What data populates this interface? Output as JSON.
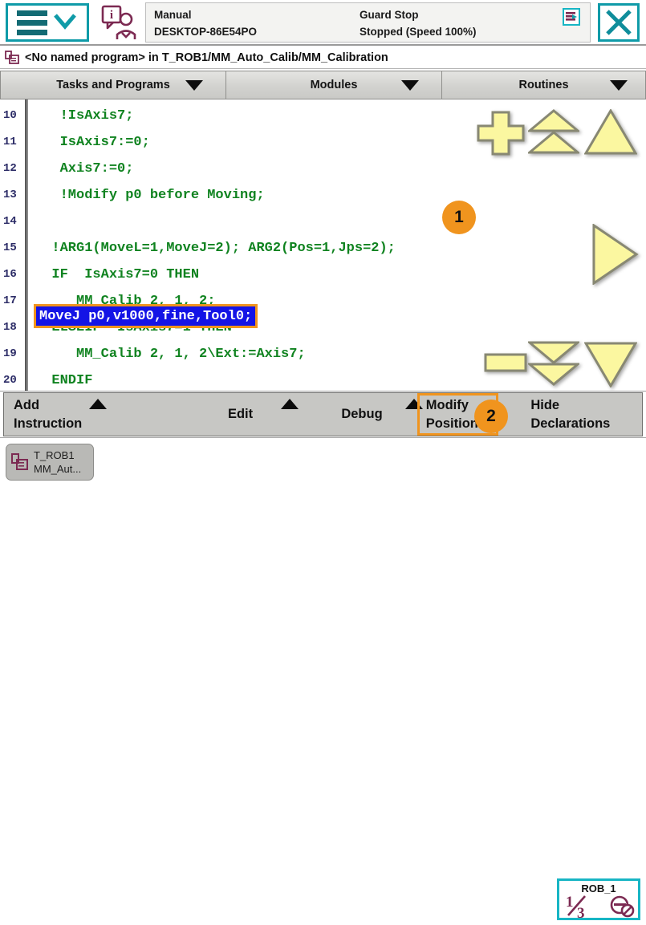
{
  "header": {
    "menu_icon": "hamburger-menu-icon",
    "menu_chevron_icon": "chevron-down-icon",
    "operator_icon": "operator-info-icon",
    "mode": "Manual",
    "controller": "DESKTOP-86E54PO",
    "guard_state": "Guard Stop",
    "run_state": "Stopped (Speed 100%)",
    "warning_icon": "event-log-icon",
    "close_icon": "close-icon",
    "accent_teal": "#0f9ba8"
  },
  "path_bar": {
    "icon": "program-icon",
    "text": "<No named program>  in  T_ROB1/MM_Auto_Calib/MM_Calibration"
  },
  "tabs": [
    {
      "label": "Tasks and Programs",
      "caret": "caret-down-icon"
    },
    {
      "label": "Modules",
      "caret": "caret-down-icon"
    },
    {
      "label": "Routines",
      "caret": "caret-down-icon"
    }
  ],
  "editor": {
    "selected_line": 14,
    "selection_bg": "#1414e6",
    "selection_border": "#f0941e",
    "code_color": "#108320",
    "lines": [
      {
        "no": "10",
        "text": "   !IsAxis7;"
      },
      {
        "no": "11",
        "text": "   IsAxis7:=0;"
      },
      {
        "no": "12",
        "text": "   Axis7:=0;"
      },
      {
        "no": "13",
        "text": "   !Modify p0 before Moving;"
      },
      {
        "no": "14",
        "text": "MoveJ p0,v1000,fine,Tool0;"
      },
      {
        "no": "15",
        "text": "  !ARG1(MoveL=1,MoveJ=2); ARG2(Pos=1,Jps=2);"
      },
      {
        "no": "16",
        "text": "  IF  IsAxis7=0 THEN"
      },
      {
        "no": "17",
        "text": "     MM_Calib 2, 1, 2;"
      },
      {
        "no": "18",
        "text": "  ELSEIF  IsAxis7=1 THEN"
      },
      {
        "no": "19",
        "text": "     MM_Calib 2, 1, 2\\Ext:=Axis7;"
      },
      {
        "no": "20",
        "text": "  ENDIF"
      }
    ]
  },
  "nav_buttons": {
    "add_icon": "plus-icon",
    "page_up_icon": "double-chevron-up-icon",
    "top_icon": "triangle-up-icon",
    "step_into_icon": "triangle-right-icon",
    "remove_icon": "minus-icon",
    "page_down_icon": "double-chevron-down-icon",
    "bottom_icon": "triangle-down-icon",
    "color": "#fbf7a0"
  },
  "badges": [
    {
      "number": "1",
      "color": "#f0941e"
    },
    {
      "number": "2",
      "color": "#f0941e"
    }
  ],
  "toolbar": {
    "add_instruction_l1": "Add",
    "add_instruction_l2": "Instruction",
    "edit": "Edit",
    "debug": "Debug",
    "modify_position_l1": "Modify",
    "modify_position_l2": "Position",
    "hide_declarations_l1": "Hide",
    "hide_declarations_l2": "Declarations",
    "caret_icon": "caret-up-icon",
    "highlight_color": "#f0941e"
  },
  "statusbar": {
    "task_icon": "task-icon",
    "task_line1": "T_ROB1",
    "task_line2": "MM_Aut...",
    "rob_label": "ROB_1",
    "rob_fraction": "1/3",
    "rob_numerator": "1",
    "rob_denominator": "3",
    "rotation_icon": "jog-rotation-icon",
    "border_color": "#17b5c4"
  }
}
